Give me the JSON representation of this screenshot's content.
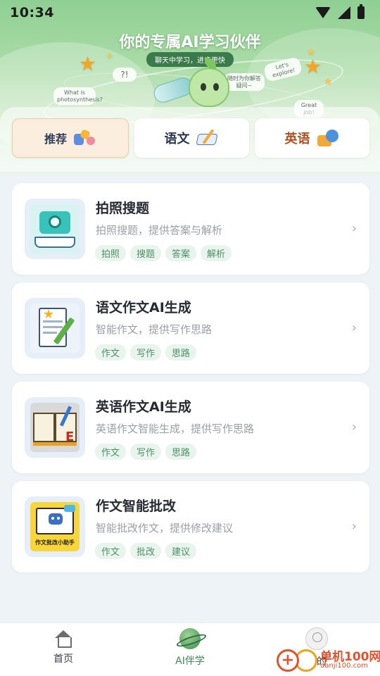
{
  "status_bar": {
    "time": "10:34"
  },
  "hero": {
    "title": "你的专属AI学习伙伴",
    "subtitle": "聊天中学习，进步更快",
    "bubbles": [
      "What is photosynthesis?",
      "随时为你解答疑问~",
      "Let's explore!",
      "Great job!"
    ]
  },
  "tabs": [
    {
      "label": "推荐",
      "active": true
    },
    {
      "label": "语文",
      "active": false
    },
    {
      "label": "英语",
      "active": false
    }
  ],
  "cards": [
    {
      "title": "拍照搜题",
      "desc": "拍照搜题，提供答案与解析",
      "tags": [
        "拍照",
        "搜题",
        "答案",
        "解析"
      ]
    },
    {
      "title": "语文作文AI生成",
      "desc": "智能作文，提供写作思路",
      "tags": [
        "作文",
        "写作",
        "思路"
      ]
    },
    {
      "title": "英语作文AI生成",
      "desc": "英语作文智能生成，提供写作思路",
      "tags": [
        "作文",
        "写作",
        "思路"
      ]
    },
    {
      "title": "作文智能批改",
      "desc": "智能批改作文，提供修改建议",
      "tags": [
        "作文",
        "批改",
        "建议"
      ],
      "thumb_caption": "作文批改小助手"
    }
  ],
  "bottom_nav": [
    {
      "label": "首页",
      "icon": "home-icon"
    },
    {
      "label": "AI伴学",
      "icon": "planet-icon",
      "active": true
    },
    {
      "label": "我的",
      "icon": "avatar-icon"
    }
  ],
  "watermark": {
    "name": "单机100网",
    "url": "danji100.com"
  },
  "colors": {
    "accent_green": "#3f8b55",
    "tag_bg": "#eaf4ee",
    "active_tab_bg": "#fbeede"
  }
}
